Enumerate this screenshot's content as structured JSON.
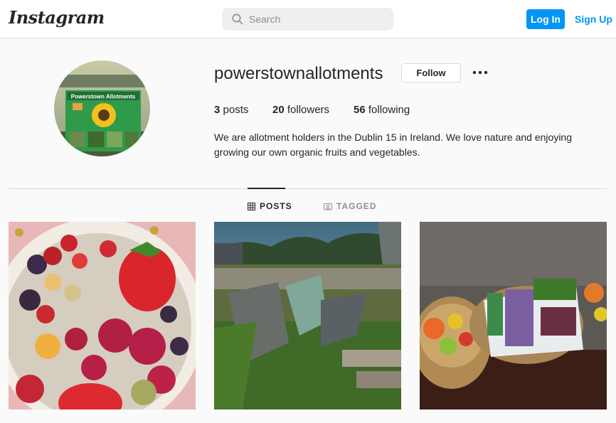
{
  "nav": {
    "logo": "Instagram",
    "search_placeholder": "Search",
    "login_label": "Log In",
    "signup_label": "Sign Up"
  },
  "profile": {
    "username": "powerstownallotments",
    "follow_label": "Follow",
    "posts_count": "3",
    "posts_label": "posts",
    "followers_count": "20",
    "followers_label": "followers",
    "following_count": "56",
    "following_label": "following",
    "bio": "We are allotment holders in the Dublin 15 in Ireland. We love nature and enjoying growing our own organic fruits and vegetables.",
    "avatar_sign_text": "Powerstown Allotments"
  },
  "tabs": [
    {
      "label": "POSTS",
      "active": true
    },
    {
      "label": "TAGGED",
      "active": false
    }
  ],
  "colors": {
    "accent": "#0095f6",
    "text": "#262626",
    "muted": "#8e8e8e",
    "border": "#dbdbdb",
    "background": "#fafafa"
  }
}
